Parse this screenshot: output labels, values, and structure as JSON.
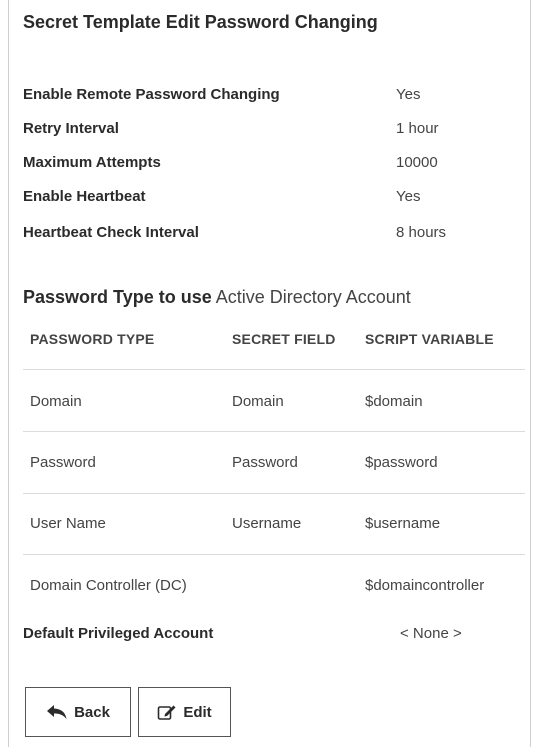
{
  "title": "Secret Template Edit Password Changing",
  "settings": [
    {
      "label": "Enable Remote Password Changing",
      "value": "Yes"
    },
    {
      "label": "Retry Interval",
      "value": "1 hour"
    },
    {
      "label": "Maximum Attempts",
      "value": "10000"
    },
    {
      "label": "Enable Heartbeat",
      "value": "Yes"
    },
    {
      "label": "Heartbeat Check Interval",
      "value": "8 hours"
    }
  ],
  "password_type": {
    "label": "Password Type to use",
    "value": "Active Directory Account"
  },
  "table": {
    "headers": [
      "PASSWORD TYPE",
      "SECRET FIELD",
      "SCRIPT VARIABLE"
    ],
    "rows": [
      [
        "Domain",
        "Domain",
        "$domain"
      ],
      [
        "Password",
        "Password",
        "$password"
      ],
      [
        "User Name",
        "Username",
        "$username"
      ],
      [
        "Domain Controller (DC)",
        "",
        "$domaincontroller"
      ]
    ]
  },
  "default_account": {
    "label": "Default Privileged Account",
    "value": "< None >"
  },
  "buttons": {
    "back": "Back",
    "edit": "Edit"
  },
  "icons": {
    "back": "reply-arrow-icon",
    "edit": "pencil-square-icon"
  }
}
